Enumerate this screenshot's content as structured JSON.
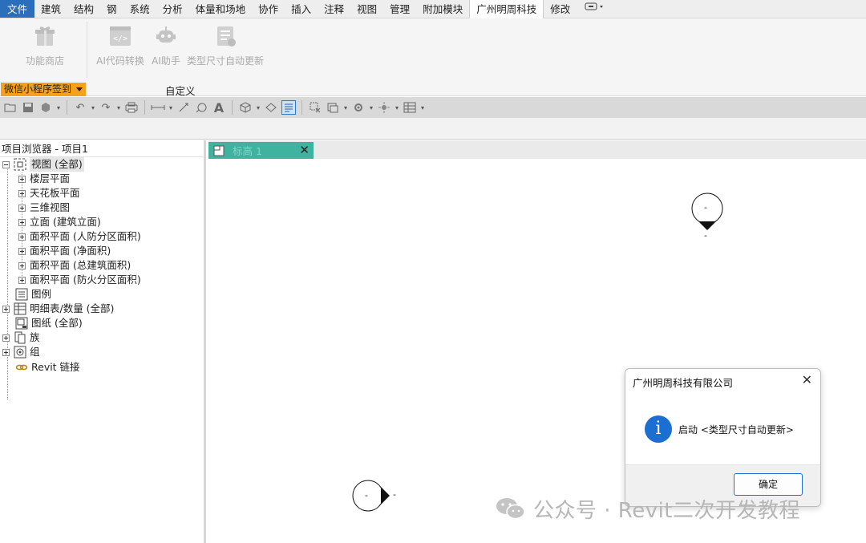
{
  "ribbon": {
    "file_tab": "文件",
    "tabs": [
      "建筑",
      "结构",
      "钢",
      "系统",
      "分析",
      "体量和场地",
      "协作",
      "插入",
      "注释",
      "视图",
      "管理",
      "附加模块",
      "广州明周科技",
      "修改"
    ],
    "active_tab": "广州明周科技",
    "buttons": {
      "store": "功能商店",
      "ai_code": "AI代码转换",
      "ai_assistant": "AI助手",
      "type_dim_update": "类型尺寸自动更新"
    },
    "panel_titles": {
      "signin": "微信小程序签到",
      "custom": "自定义"
    }
  },
  "browser": {
    "title": "项目浏览器 - 项目1",
    "items": [
      {
        "label": "视图 (全部)",
        "icon": "views-icon"
      },
      {
        "label": "楼层平面"
      },
      {
        "label": "天花板平面"
      },
      {
        "label": "三维视图"
      },
      {
        "label": "立面 (建筑立面)"
      },
      {
        "label": "面积平面 (人防分区面积)"
      },
      {
        "label": "面积平面 (净面积)"
      },
      {
        "label": "面积平面 (总建筑面积)"
      },
      {
        "label": "面积平面 (防火分区面积)"
      },
      {
        "label": "图例",
        "icon": "legend-icon"
      },
      {
        "label": "明细表/数量 (全部)",
        "icon": "schedule-icon"
      },
      {
        "label": "图纸 (全部)",
        "icon": "sheet-icon"
      },
      {
        "label": "族",
        "icon": "family-icon"
      },
      {
        "label": "组",
        "icon": "group-icon"
      },
      {
        "label": "Revit 链接",
        "icon": "link-icon"
      }
    ]
  },
  "view": {
    "tab_label": "标高 1",
    "marker_top_label": "-",
    "marker_top_sub": "-",
    "marker_bottom_label": "-",
    "marker_bottom_side": "-"
  },
  "dialog": {
    "title": "广州明周科技有限公司",
    "message": "启动 <类型尺寸自动更新>",
    "ok_label": "确定"
  },
  "watermark": {
    "text": "公众号 · Revit二次开发教程"
  },
  "colors": {
    "file_tab": "#2b6fbc",
    "panel_title_accent": "#f4a11e",
    "view_tab": "#3fb3a0",
    "info_icon": "#1a6fd1"
  }
}
